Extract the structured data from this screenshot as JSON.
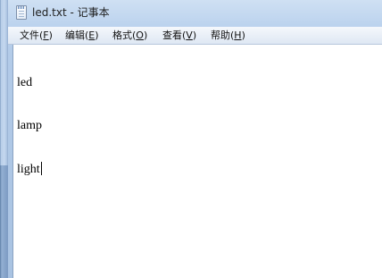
{
  "window": {
    "title": "led.txt - 记事本",
    "icon": "notepad-icon"
  },
  "menubar": {
    "items": [
      {
        "label": "文件(",
        "mnemonic": "F",
        "suffix": ")"
      },
      {
        "label": "编辑(",
        "mnemonic": "E",
        "suffix": ")"
      },
      {
        "label": "格式(",
        "mnemonic": "O",
        "suffix": ")"
      },
      {
        "label": "查看(",
        "mnemonic": "V",
        "suffix": ")"
      },
      {
        "label": "帮助(",
        "mnemonic": "H",
        "suffix": ")"
      }
    ]
  },
  "editor": {
    "lines": [
      "led",
      "lamp",
      "light"
    ]
  }
}
